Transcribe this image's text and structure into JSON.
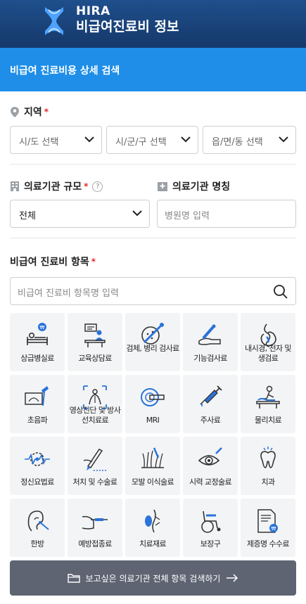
{
  "header": {
    "brand_line1": "HIRA",
    "brand_line2": "비급여진료비 정보"
  },
  "page_title": "비급여 진료비용 상세 검색",
  "region": {
    "label": "지역",
    "required_mark": "*",
    "sido_placeholder": "시/도 선택",
    "sigungu_placeholder": "시/군/구 선택",
    "emd_placeholder": "읍/면/동 선택"
  },
  "scale": {
    "label": "의료기관 규모",
    "required_mark": "*",
    "help": "?",
    "value": "전체"
  },
  "hospital_name": {
    "label": "의료기관 명칭",
    "placeholder": "병원명 입력"
  },
  "items": {
    "label": "비급여 진료비 항목",
    "required_mark": "*",
    "search_placeholder": "비급여 진료비 항목명 입력",
    "tiles": [
      {
        "label": "상급병실료",
        "icon": "hospital-bed-icon"
      },
      {
        "label": "교육상담료",
        "icon": "counseling-icon"
      },
      {
        "label": "검체, 병리 검사료",
        "icon": "specimen-test-icon"
      },
      {
        "label": "기능검사료",
        "icon": "function-test-icon"
      },
      {
        "label": "내시경, 천자 및 생검료",
        "icon": "endoscope-icon"
      },
      {
        "label": "초음파",
        "icon": "ultrasound-icon"
      },
      {
        "label": "영상진단 및 방사선치료료",
        "icon": "radiology-icon"
      },
      {
        "label": "MRI",
        "icon": "mri-icon"
      },
      {
        "label": "주사료",
        "icon": "syringe-icon"
      },
      {
        "label": "물리치료",
        "icon": "physical-therapy-icon"
      },
      {
        "label": "정신요법료",
        "icon": "psychotherapy-icon"
      },
      {
        "label": "처치 및 수술료",
        "icon": "surgery-icon"
      },
      {
        "label": "모발 이식술료",
        "icon": "hair-transplant-icon"
      },
      {
        "label": "시력 교정술료",
        "icon": "vision-correction-icon"
      },
      {
        "label": "치과",
        "icon": "tooth-icon"
      },
      {
        "label": "한방",
        "icon": "acupuncture-icon"
      },
      {
        "label": "예방접종료",
        "icon": "vaccination-icon"
      },
      {
        "label": "치료재료",
        "icon": "treatment-material-icon"
      },
      {
        "label": "보장구",
        "icon": "wheelchair-icon"
      },
      {
        "label": "제증명 수수료",
        "icon": "certificate-icon"
      }
    ]
  },
  "search_all_button": "보고싶은 의료기관 전체 항목 검색하기",
  "colors": {
    "header": "#15386a",
    "title_bar": "#1e8ee8",
    "accent_blue": "#2a73d9",
    "button": "#5e6472"
  }
}
